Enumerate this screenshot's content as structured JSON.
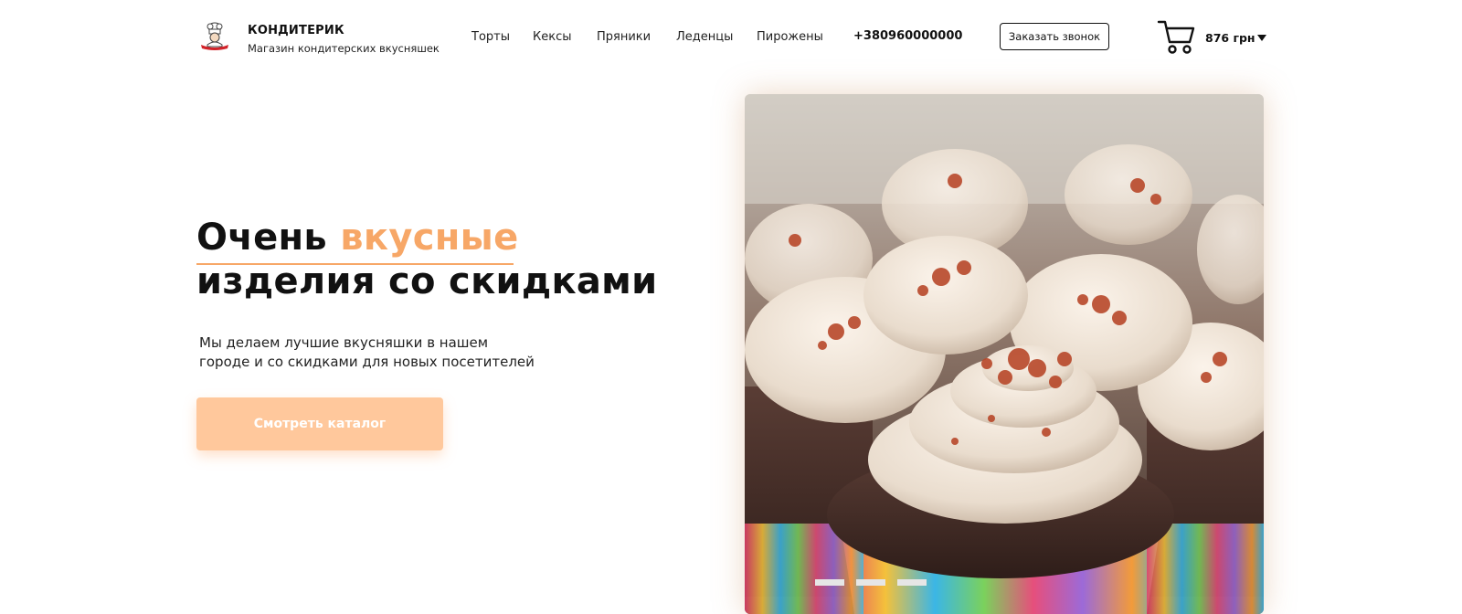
{
  "brand": {
    "name": "КОНДИТЕРИК",
    "subtitle": "Магазин кондитерских вкусняшек"
  },
  "nav": {
    "items": [
      {
        "label": "Торты"
      },
      {
        "label": "Кексы"
      },
      {
        "label": "Пряники"
      },
      {
        "label": "Леденцы"
      },
      {
        "label": "Пирожены"
      }
    ]
  },
  "header": {
    "phone": "+380960000000",
    "callback_label": "Заказать звонок",
    "cart_total": "876 грн",
    "cart_icon": "shopping-cart-icon",
    "caret_icon": "caret-down-icon"
  },
  "hero": {
    "title_word1": "Очень",
    "title_accent": "вкусные",
    "title_line2": "изделия со скидками",
    "description_line1": "Мы делаем лучшие вкусняшки в нашем",
    "description_line2": "городе и со скидками для новых посетителей",
    "cta_label": "Смотреть каталог"
  },
  "slider": {
    "slide_count": 3,
    "active_index": 0
  },
  "colors": {
    "accent": "#f7a767",
    "cta_bg": "#ffc89c",
    "text": "#111111"
  }
}
